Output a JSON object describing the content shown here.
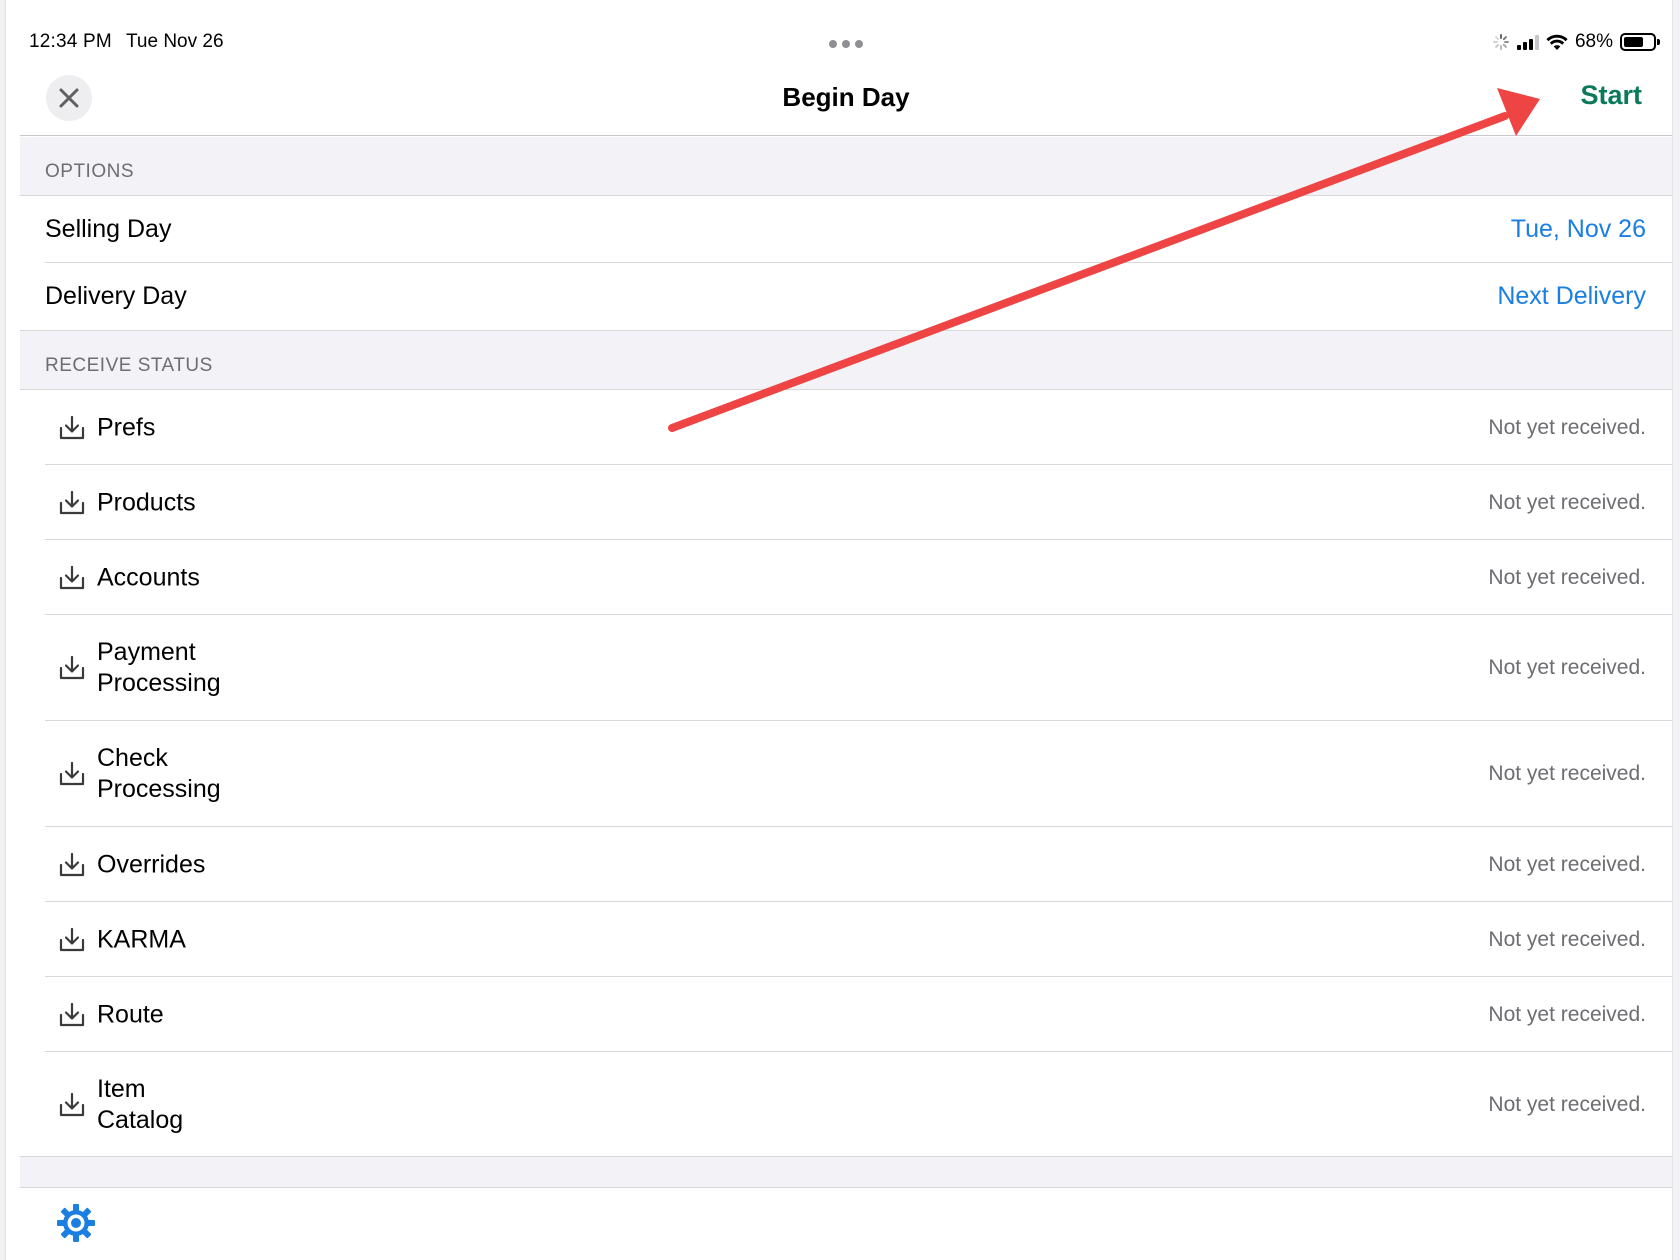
{
  "status_bar": {
    "time": "12:34 PM",
    "date": "Tue Nov 26",
    "battery": "68%",
    "battery_level": 0.68
  },
  "nav": {
    "title": "Begin Day",
    "start_label": "Start",
    "close_icon": "close-icon"
  },
  "options": {
    "header": "OPTIONS",
    "selling_day_label": "Selling Day",
    "selling_day_value": "Tue, Nov 26",
    "delivery_day_label": "Delivery Day",
    "delivery_day_value": "Next Delivery"
  },
  "receive_status": {
    "header": "RECEIVE STATUS",
    "items": [
      {
        "line1": "Prefs",
        "line2": "",
        "status": "Not yet received."
      },
      {
        "line1": "Products",
        "line2": "",
        "status": "Not yet received."
      },
      {
        "line1": "Accounts",
        "line2": "",
        "status": "Not yet received."
      },
      {
        "line1": "Payment",
        "line2": "Processing",
        "status": "Not yet received."
      },
      {
        "line1": "Check",
        "line2": "Processing",
        "status": "Not yet received."
      },
      {
        "line1": "Overrides",
        "line2": "",
        "status": "Not yet received."
      },
      {
        "line1": "KARMA",
        "line2": "",
        "status": "Not yet received."
      },
      {
        "line1": "Route",
        "line2": "",
        "status": "Not yet received."
      },
      {
        "line1": "Item",
        "line2": "Catalog",
        "status": "Not yet received."
      }
    ]
  },
  "toolbar": {
    "settings_icon": "gear-icon"
  },
  "colors": {
    "accent_green": "#0b7a5b",
    "link_blue": "#1a7fe0",
    "annotation_red": "#ee4444",
    "gear_blue": "#1a7fe0"
  }
}
